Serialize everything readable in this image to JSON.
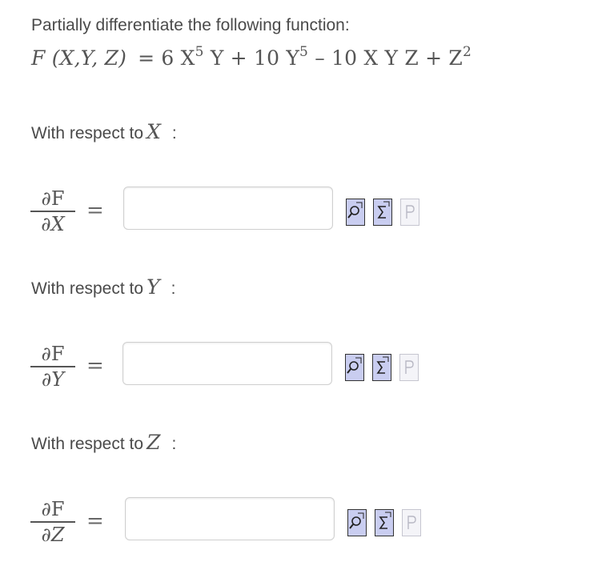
{
  "instruction": "Partially differentiate the following function:",
  "function_expr": {
    "lhs": "F (X,Y, Z)",
    "rhs_parts": [
      "= 6 X",
      "5",
      " Y + 10 Y",
      "5",
      " – 10 X Y Z + Z",
      "2"
    ]
  },
  "sections": [
    {
      "label": "With respect to",
      "variable": "X",
      "colon": ":",
      "numerator": "∂F",
      "denominator_d": "∂",
      "denominator_var": "X",
      "equals": "=",
      "input_value": "",
      "tools": [
        "preview-icon",
        "equation-editor-icon",
        "p-icon"
      ]
    },
    {
      "label": "With respect to",
      "variable": "Y",
      "colon": ":",
      "numerator": "∂F",
      "denominator_d": "∂",
      "denominator_var": "Y",
      "equals": "=",
      "input_value": "",
      "tools": [
        "preview-icon",
        "equation-editor-icon",
        "p-icon"
      ]
    },
    {
      "label": "With respect to",
      "variable": "Z",
      "colon": ":",
      "numerator": "∂F",
      "denominator_d": "∂",
      "denominator_var": "Z",
      "equals": "=",
      "input_value": "",
      "tools": [
        "preview-icon",
        "equation-editor-icon",
        "p-icon"
      ]
    }
  ],
  "colors": {
    "tool_fill": "#c9cdf0",
    "tool_border": "#333333",
    "disabled_tool": "#c6c6d0",
    "input_border": "#cfcfcf"
  }
}
